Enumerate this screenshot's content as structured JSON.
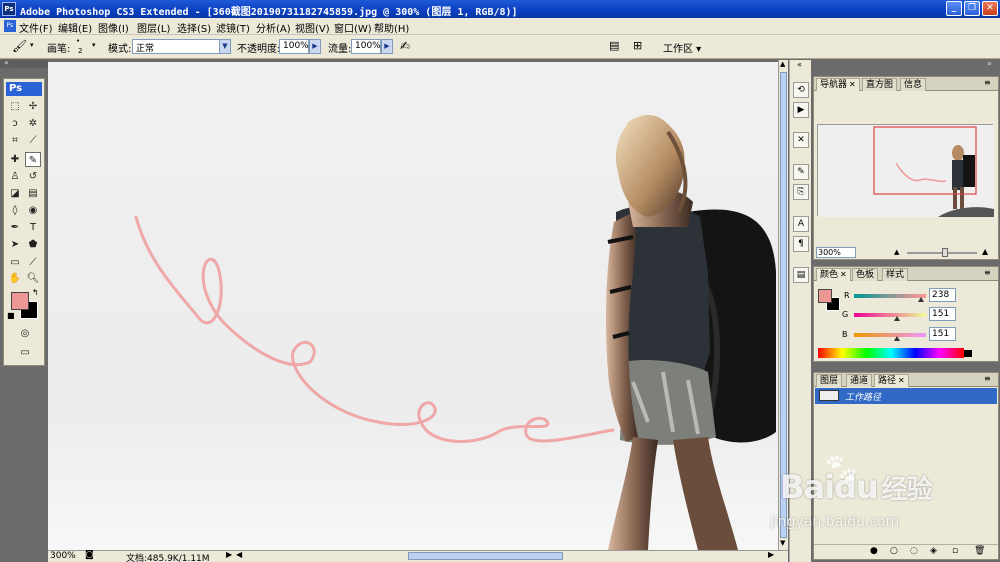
{
  "window": {
    "title": "Adobe Photoshop CS3 Extended - [360截图20190731182745859.jpg @ 300% (图层 1, RGB/8)]",
    "logo": "Ps",
    "buttons": {
      "minimize": "_",
      "restore": "❐",
      "close": "✕"
    }
  },
  "menu": [
    "文件(F)",
    "编辑(E)",
    "图像(I)",
    "图层(L)",
    "选择(S)",
    "滤镜(T)",
    "分析(A)",
    "视图(V)",
    "窗口(W)",
    "帮助(H)"
  ],
  "options": {
    "brush_label": "画笔:",
    "brush_size": "2",
    "mode_label": "模式:",
    "mode_value": "正常",
    "opacity_label": "不透明度:",
    "opacity_value": "100%",
    "flow_label": "流量:",
    "flow_value": "100%",
    "workspace": "工作区 ▾"
  },
  "toolbox": {
    "header": "Ps"
  },
  "colors": {
    "foreground": "#ee9797",
    "background": "#000000",
    "path_stroke": "#ef9a9a",
    "accent": "#3169c6"
  },
  "status": {
    "zoom": "300%",
    "doc_info": "文档:485.9K/1.11M"
  },
  "navigator": {
    "tabs": [
      "导航器",
      "直方图",
      "信息"
    ],
    "zoom": "300%"
  },
  "color_panel": {
    "tabs": [
      "颜色",
      "色板",
      "样式"
    ],
    "channels": [
      {
        "label": "R",
        "value": "238",
        "fraction": 0.93
      },
      {
        "label": "G",
        "value": "151",
        "fraction": 0.59
      },
      {
        "label": "B",
        "value": "151",
        "fraction": 0.59
      }
    ]
  },
  "paths_panel": {
    "tabs": [
      "图层",
      "通道",
      "路径"
    ],
    "items": [
      {
        "name": "工作路径"
      }
    ]
  },
  "watermark": {
    "brand": "Baidu",
    "brand_cn": "经验",
    "url": "jingyan.baidu.com"
  }
}
